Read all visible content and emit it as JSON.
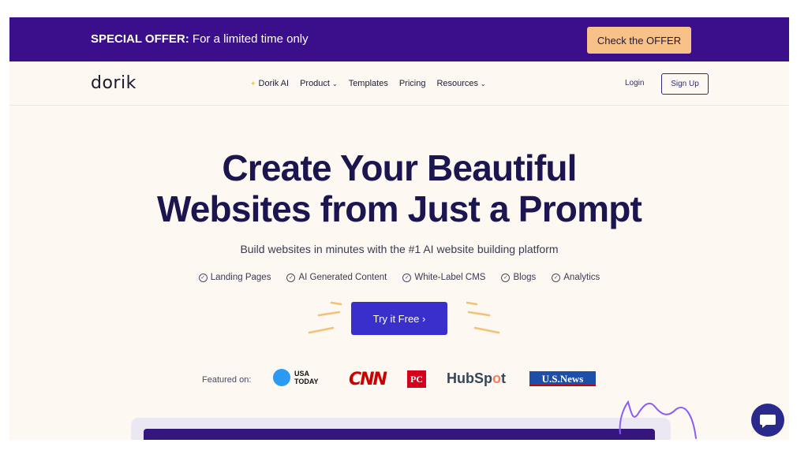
{
  "promo": {
    "bold": "SPECIAL OFFER:",
    "text": " For a limited time only",
    "button": "Check the OFFER"
  },
  "nav": {
    "logo": "dorik",
    "links": [
      {
        "label": "Dorik AI",
        "icon": "sparkle-icon"
      },
      {
        "label": "Product",
        "caret": true
      },
      {
        "label": "Templates"
      },
      {
        "label": "Pricing"
      },
      {
        "label": "Resources",
        "caret": true
      }
    ],
    "login": "Login",
    "signup": "Sign Up"
  },
  "hero": {
    "headline_line1": "Create Your Beautiful",
    "headline_line2": "Websites from Just a Prompt",
    "subtitle": "Build websites in minutes with the #1 AI website building platform",
    "features": [
      "Landing Pages",
      "AI Generated Content",
      "White-Label CMS",
      "Blogs",
      "Analytics"
    ],
    "cta": "Try it Free ›"
  },
  "featured": {
    "label": "Featured on:",
    "usa_today": [
      "USA",
      "TODAY"
    ],
    "cnn": "CNN",
    "pc": "PC",
    "hubspot_pre": "HubSp",
    "hubspot_o": "o",
    "hubspot_post": "t",
    "usnews": "U.S.News"
  },
  "colors": {
    "promo_bg": "#3b0f8c",
    "offer_button": "#f7c188",
    "cta": "#3a2fcb",
    "page_bg": "#fdf8f2",
    "headline": "#1b1550"
  },
  "icons": [
    "check-circle-icon",
    "chat-bubble-icon",
    "sparkle-icon",
    "chevron-down-icon"
  ]
}
